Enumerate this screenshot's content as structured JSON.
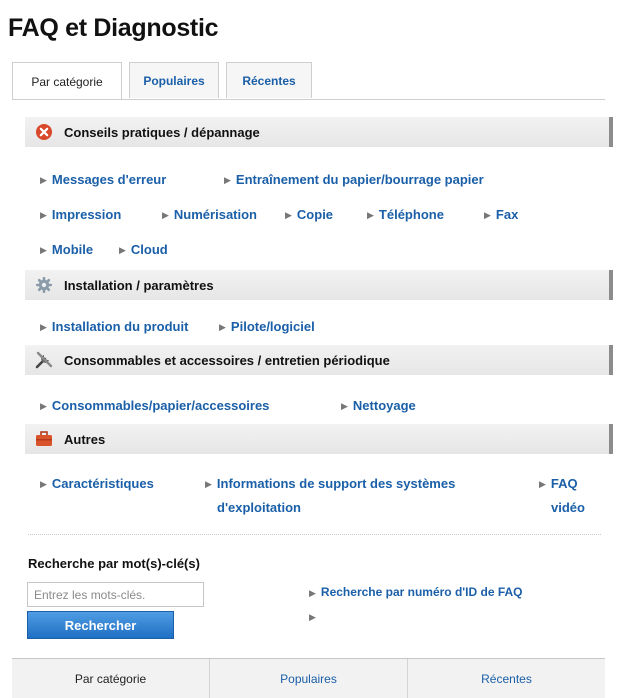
{
  "page": {
    "title": "FAQ et Diagnostic"
  },
  "tabs": [
    "Par catégorie",
    "Populaires",
    "Récentes"
  ],
  "sections": [
    {
      "icon": "x-circle-icon",
      "title": "Conseils pratiques / dépannage",
      "rows": [
        [
          "Messages d'erreur",
          "Entraînement du papier/bourrage papier"
        ],
        [
          "Impression",
          "Numérisation",
          "Copie",
          "Téléphone",
          "Fax"
        ],
        [
          "Mobile",
          "Cloud"
        ]
      ]
    },
    {
      "icon": "gear-icon",
      "title": "Installation / paramètres",
      "rows": [
        [
          "Installation du produit",
          "Pilote/logiciel"
        ]
      ]
    },
    {
      "icon": "tools-icon",
      "title": "Consommables et accessoires / entretien périodique",
      "rows": [
        [
          "Consommables/papier/accessoires",
          "Nettoyage"
        ]
      ]
    },
    {
      "icon": "briefcase-icon",
      "title": "Autres",
      "rows": [
        [
          "Caractéristiques",
          "Informations de support des systèmes",
          "d'exploitation",
          "FAQ",
          "vidéo"
        ]
      ]
    }
  ],
  "search": {
    "label": "Recherche par mot(s)-clé(s)",
    "placeholder": "Entrez les mots-clés.",
    "button": "Rechercher",
    "id_link": "Recherche par numéro d'ID de FAQ"
  },
  "colors": {
    "link": "#1a5fa8",
    "button": "#2a7ed3",
    "error_icon": "#d9482b",
    "briefcase": "#d9532b"
  }
}
